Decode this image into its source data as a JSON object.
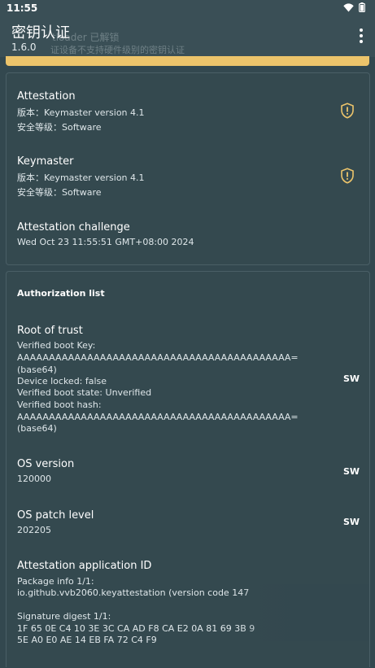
{
  "status_bar": {
    "time": "11:55"
  },
  "app_bar": {
    "title": "密钥认证",
    "version": "1.6.0",
    "ghost_line1": "tloader 已解锁",
    "ghost_line2": "证设备不支持硬件级别的密钥认证"
  },
  "colors": {
    "background": "#33484f",
    "banner": "#ecc46b",
    "shield": "#ecc46b"
  },
  "attestation": {
    "label": "Attestation",
    "version": "版本：Keymaster version 4.1",
    "security": "安全等级：Software"
  },
  "keymaster": {
    "label": "Keymaster",
    "version": "版本：Keymaster version 4.1",
    "security": "安全等级：Software"
  },
  "challenge": {
    "label": "Attestation challenge",
    "value": "Wed Oct 23 11:55:51 GMT+08:00 2024"
  },
  "auth": {
    "header": "Authorization list",
    "root_of_trust": {
      "label": "Root of trust",
      "lines": [
        "Verified boot Key:",
        "AAAAAAAAAAAAAAAAAAAAAAAAAAAAAAAAAAAAAAAAAAA=",
        "(base64)",
        "Device locked: false",
        "Verified boot state: Unverified",
        "Verified boot hash:",
        "AAAAAAAAAAAAAAAAAAAAAAAAAAAAAAAAAAAAAAAAAAA=",
        "(base64)"
      ],
      "badge": "SW"
    },
    "os_version": {
      "label": "OS version",
      "value": "120000",
      "badge": "SW"
    },
    "os_patch": {
      "label": "OS patch level",
      "value": "202205",
      "badge": "SW"
    },
    "app_id": {
      "label": "Attestation application ID",
      "lines": [
        "Package info 1/1:",
        "io.github.vvb2060.keyattestation (version code 147",
        "",
        "Signature digest 1/1:",
        "1F 65 0E C4 10 3E 3C CA AD F8 CA E2 0A 81 69 3B 9",
        "5E A0 E0 AE 14 EB FA 72 C4 F9"
      ]
    }
  }
}
